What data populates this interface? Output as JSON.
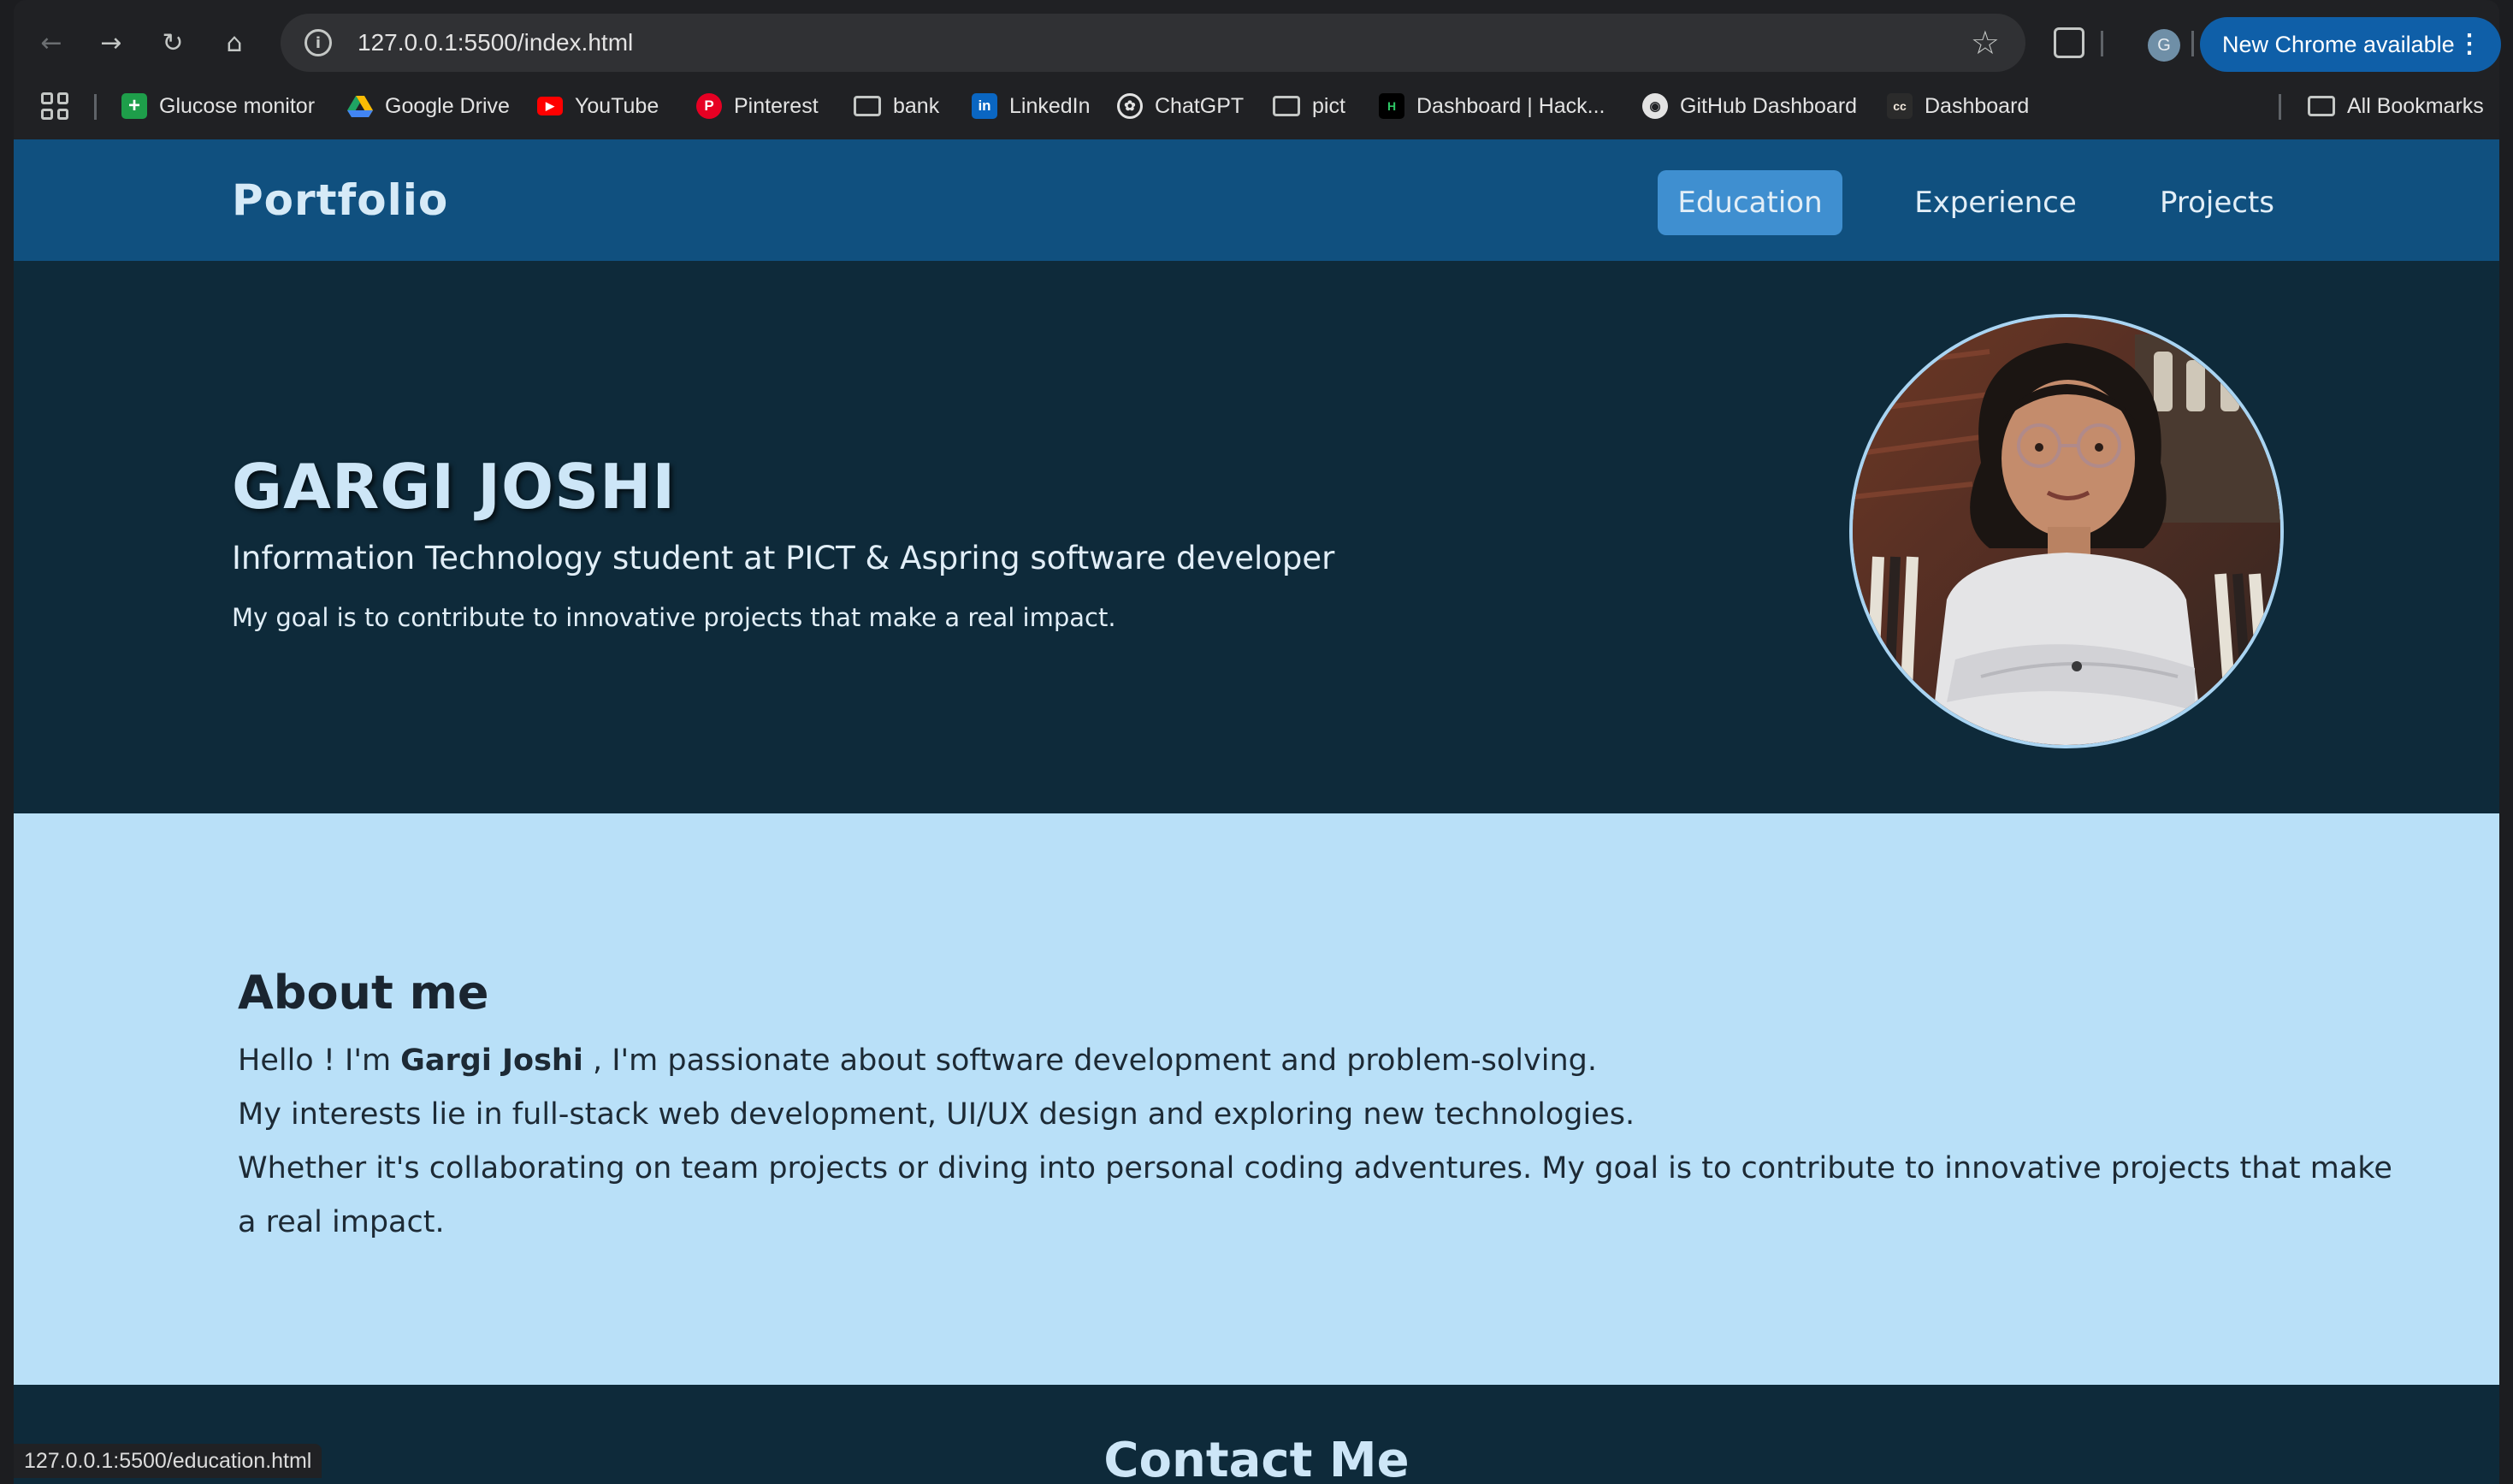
{
  "browser": {
    "url": "127.0.0.1:5500/index.html",
    "update_label": "New Chrome available",
    "profile_initial": "G",
    "status_url": "127.0.0.1:5500/education.html",
    "bookmarks": [
      {
        "label": "Glucose monitor",
        "icon": "green-plus-icon"
      },
      {
        "label": "Google Drive",
        "icon": "google-drive-icon"
      },
      {
        "label": "YouTube",
        "icon": "youtube-icon"
      },
      {
        "label": "Pinterest",
        "icon": "pinterest-icon"
      },
      {
        "label": "bank",
        "icon": "folder-icon"
      },
      {
        "label": "LinkedIn",
        "icon": "linkedin-icon"
      },
      {
        "label": "ChatGPT",
        "icon": "chatgpt-icon"
      },
      {
        "label": "pict",
        "icon": "folder-icon"
      },
      {
        "label": "Dashboard | Hack...",
        "icon": "hackerrank-icon"
      },
      {
        "label": "GitHub Dashboard",
        "icon": "github-icon"
      },
      {
        "label": "Dashboard",
        "icon": "cc-icon"
      }
    ],
    "all_bookmarks": "All Bookmarks"
  },
  "site": {
    "brand": "Portfolio",
    "nav": [
      "Education",
      "Experience",
      "Projects"
    ],
    "active_nav": "Education",
    "hero": {
      "name": "GARGI JOSHI",
      "subtitle": "Information Technology student at PICT & Aspring software developer",
      "goal": "My goal is to contribute to innovative projects that make a real impact."
    },
    "about": {
      "title": "About me",
      "line1_pre": "Hello ! I'm ",
      "line1_name": "Gargi Joshi",
      "line1_post": " , I'm passionate about software development and problem-solving.",
      "line2": "My interests lie in full-stack web development, UI/UX design and exploring new technologies.",
      "line3": "Whether it's collaborating on team projects or diving into personal coding adventures. My goal is to contribute to innovative projects that make a real impact."
    },
    "contact_title": "Contact Me"
  },
  "colors": {
    "nav_bg": "#10507f",
    "hero_bg": "#0e2a3a",
    "about_bg": "#b9e0f8",
    "active_nav": "#3f8fd0"
  }
}
